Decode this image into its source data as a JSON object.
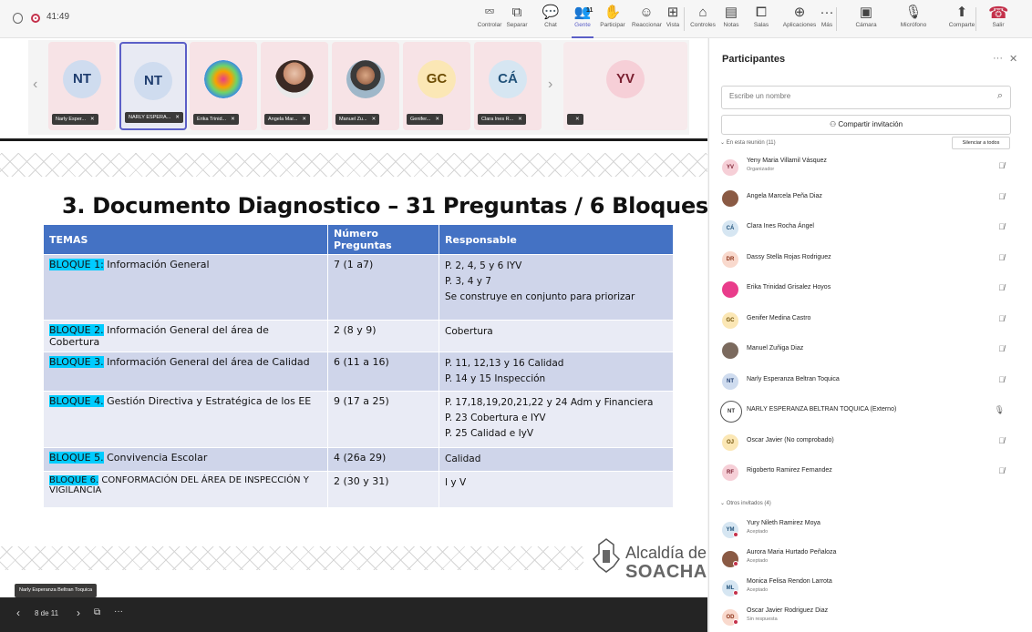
{
  "topbar": {
    "time": "41:49",
    "buttons": [
      {
        "name": "controlar",
        "label": "Controlar",
        "icon": "pointer-icon",
        "glyph": "⮹"
      },
      {
        "name": "separar",
        "label": "Separar",
        "icon": "pop-out-icon",
        "glyph": "⧉"
      },
      {
        "name": "chat",
        "label": "Chat",
        "icon": "chat-icon",
        "glyph": "💬"
      },
      {
        "name": "gente",
        "label": "Gente",
        "icon": "people-icon",
        "glyph": "👥",
        "badge": "11"
      },
      {
        "name": "participar",
        "label": "Participar",
        "icon": "raise-hand-icon",
        "glyph": "✋"
      },
      {
        "name": "reaccionar",
        "label": "Reaccionar",
        "icon": "emoji-icon",
        "glyph": "☺"
      },
      {
        "name": "vista",
        "label": "Vista",
        "icon": "grid-icon",
        "glyph": "⊞"
      },
      {
        "name": "controles",
        "label": "Controles",
        "icon": "control-icon",
        "glyph": "⌂"
      },
      {
        "name": "notas",
        "label": "Notas",
        "icon": "notes-icon",
        "glyph": "▤"
      },
      {
        "name": "salas",
        "label": "Salas",
        "icon": "rooms-icon",
        "glyph": "⧠"
      },
      {
        "name": "aplicaciones",
        "label": "Aplicaciones",
        "icon": "apps-icon",
        "glyph": "⊕"
      },
      {
        "name": "mas",
        "label": "Más",
        "icon": "more-icon",
        "glyph": "···"
      },
      {
        "name": "camara",
        "label": "Cámara",
        "icon": "camera-off-icon",
        "glyph": "▣"
      },
      {
        "name": "microfono",
        "label": "Micrófono",
        "icon": "mic-off-icon",
        "glyph": "🎙"
      },
      {
        "name": "compartir",
        "label": "Comparte",
        "icon": "share-icon",
        "glyph": "⬆"
      },
      {
        "name": "salir",
        "label": "Salir",
        "icon": "hang-up-icon",
        "glyph": "☎"
      }
    ]
  },
  "strip": {
    "tiles": [
      {
        "initials": "NT",
        "label": "Narly Esper...",
        "kind": "nt"
      },
      {
        "initials": "NT",
        "label": "NARLY ESPERA...",
        "kind": "nt"
      },
      {
        "initials": "",
        "label": "Erika Trinid...",
        "kind": "erika"
      },
      {
        "initials": "",
        "label": "Angela Mar...",
        "kind": "photo"
      },
      {
        "initials": "",
        "label": "Manuel Zu...",
        "kind": "manuel"
      },
      {
        "initials": "GC",
        "label": "Genifer...",
        "kind": "gc"
      },
      {
        "initials": "CÁ",
        "label": "Clara Ines R...",
        "kind": "ca"
      },
      {
        "initials": "YV",
        "label": "",
        "kind": "yv"
      }
    ]
  },
  "slide": {
    "title": "3.  Documento Diagnostico –  31 Preguntas / 6 Bloques",
    "headers": [
      "TEMAS",
      "Número Preguntas",
      "Responsable"
    ],
    "rows": [
      {
        "bloque": "BLOQUE 1:",
        "tema": " Información General",
        "num": "7 (1 a7)",
        "resp": [
          "P. 2, 4, 5 y 6  IYV",
          "P. 3, 4 y 7",
          "Se construye en conjunto para priorizar"
        ]
      },
      {
        "bloque": "BLOQUE 2.",
        "tema": " Información General del área de Cobertura",
        "num": "2  (8 y 9)",
        "resp": [
          "Cobertura"
        ]
      },
      {
        "bloque": "BLOQUE 3.",
        "tema": " Información General del área de Calidad",
        "num": "6 (11 a 16)",
        "resp": [
          "P. 11, 12,13 y 16  Calidad",
          "P. 14 y 15 Inspección"
        ]
      },
      {
        "bloque": "BLOQUE 4.",
        "tema": " Gestión Directiva y Estratégica de los EE",
        "num": "9 (17 a 25)",
        "resp": [
          "P. 17,18,19,20,21,22 y 24 Adm y Financiera",
          "P. 23 Cobertura e  IYV",
          "P. 25 Calidad e IyV"
        ]
      },
      {
        "bloque": "BLOQUE 5.",
        "tema": " Convivencia Escolar",
        "num": "4 (26a 29)",
        "resp": [
          "Calidad"
        ]
      },
      {
        "bloque": "BLOQUE 6.",
        "tema": " CONFORMACIÓN DEL ÁREA DE INSPECCIÓN Y VIGILANCIA",
        "num": "2 (30 y 31)",
        "resp": [
          "I y V"
        ]
      }
    ],
    "logo_line1": "Alcaldía de",
    "logo_line2": "SOACHA",
    "presenter": "Narly Esperanza Beltran Toquica"
  },
  "pager": {
    "text": "8 de 11"
  },
  "panel": {
    "title": "Participantes",
    "search_placeholder": "Escribe un nombre",
    "share_label": "Compartir invitación",
    "in_meeting": "En esta reunión (11)",
    "mute_all": "Silenciar a todos",
    "others": "Otros invitados (4)",
    "participants": [
      {
        "initials": "YV",
        "name": "Yeny Maria Villamil Vásquez",
        "sub": "Organizador",
        "bg": "#f6cfd7",
        "fg": "#7a1f30"
      },
      {
        "initials": "",
        "name": "Angela Marcela Peña Diaz",
        "sub": "",
        "bg": "#8a5a44",
        "fg": "#fff"
      },
      {
        "initials": "CÁ",
        "name": "Clara Ines Rocha Ángel",
        "sub": "",
        "bg": "#d6e6f2",
        "fg": "#21527a"
      },
      {
        "initials": "DR",
        "name": "Dassy Stella Rojas Rodriguez",
        "sub": "",
        "bg": "#f9d9cd",
        "fg": "#8a3116"
      },
      {
        "initials": "",
        "name": "Erika Trinidad Grisalez Hoyos",
        "sub": "",
        "bg": "#e93c8b",
        "fg": "#fff"
      },
      {
        "initials": "GC",
        "name": "Genifer Medina Castro",
        "sub": "",
        "bg": "#fbe7b5",
        "fg": "#6d4d04"
      },
      {
        "initials": "",
        "name": "Manuel Zuñiga Diaz",
        "sub": "",
        "bg": "#7b6a5e",
        "fg": "#fff"
      },
      {
        "initials": "NT",
        "name": "Narly Esperanza Beltran Toquica",
        "sub": "",
        "bg": "#cfdcef",
        "fg": "#1e3c6e"
      },
      {
        "initials": "NT",
        "name": "NARLY ESPERANZA BELTRAN TOQUICA (Externo)",
        "sub": "",
        "bg": "#fff",
        "fg": "#333",
        "selected": true
      },
      {
        "initials": "OJ",
        "name": "Oscar Javier (No comprobado)",
        "sub": "",
        "bg": "#fbe7b5",
        "fg": "#6d4d04"
      },
      {
        "initials": "RF",
        "name": "Rigoberto Ramirez Fernandez",
        "sub": "",
        "bg": "#f6cfd7",
        "fg": "#7a1f30"
      }
    ],
    "invited": [
      {
        "initials": "YM",
        "name": "Yury Nileth Ramirez Moya",
        "sub": "Aceptado",
        "bg": "#d6e6f2",
        "fg": "#21527a"
      },
      {
        "initials": "",
        "name": "Aurora Maria Hurtado Peñaloza",
        "sub": "Aceptado",
        "bg": "#8a5a44",
        "fg": "#fff"
      },
      {
        "initials": "ML",
        "name": "Monica Felisa Rendon Larrota",
        "sub": "Aceptado",
        "bg": "#d6e6f2",
        "fg": "#21527a"
      },
      {
        "initials": "OD",
        "name": "Oscar Javier Rodriguez Diaz",
        "sub": "Sin respuesta",
        "bg": "#f9d9cd",
        "fg": "#8a3116"
      }
    ]
  }
}
